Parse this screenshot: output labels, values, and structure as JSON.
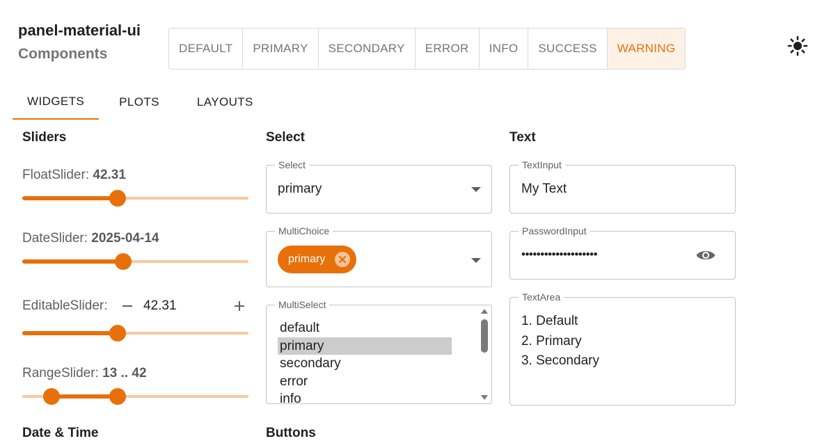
{
  "header": {
    "title": "panel-material-ui",
    "subtitle": "Components"
  },
  "color_buttons": [
    {
      "label": "DEFAULT"
    },
    {
      "label": "PRIMARY"
    },
    {
      "label": "SECONDARY"
    },
    {
      "label": "ERROR"
    },
    {
      "label": "INFO"
    },
    {
      "label": "SUCCESS"
    },
    {
      "label": "WARNING",
      "active": true
    }
  ],
  "theme_toggle": {
    "icon": "sun-icon"
  },
  "tabs": [
    {
      "label": "WIDGETS",
      "active": true
    },
    {
      "label": "PLOTS"
    },
    {
      "label": "LAYOUTS"
    }
  ],
  "accent_color": "#e8700a",
  "sections": {
    "sliders": "Sliders",
    "select": "Select",
    "text": "Text",
    "date_time": "Date & Time",
    "buttons": "Buttons"
  },
  "sliders": {
    "float": {
      "label": "FloatSlider: ",
      "value": "42.31",
      "fraction": 0.42
    },
    "date": {
      "label": "DateSlider: ",
      "value": "2025-04-14",
      "fraction": 0.445
    },
    "editable": {
      "label": "EditableSlider:",
      "value": "42.31",
      "fraction": 0.42,
      "minus_icon": "minus-icon",
      "plus_icon": "plus-icon"
    },
    "range": {
      "label": "RangeSlider: ",
      "value": "13 .. 42",
      "start_fraction": 0.13,
      "end_fraction": 0.42
    }
  },
  "select": {
    "select": {
      "label": "Select",
      "value": "primary"
    },
    "multichoice": {
      "label": "MultiChoice",
      "chips": [
        "primary"
      ]
    },
    "multiselect": {
      "label": "MultiSelect",
      "options": [
        "default",
        "primary",
        "secondary",
        "error",
        "info"
      ],
      "selected": "primary"
    }
  },
  "text": {
    "text_input": {
      "label": "TextInput",
      "value": "My Text"
    },
    "password_input": {
      "label": "PasswordInput",
      "value": "••••••••••••••••••••"
    },
    "text_area": {
      "label": "TextArea",
      "lines": [
        "1. Default",
        "2. Primary",
        "3. Secondary"
      ]
    }
  }
}
